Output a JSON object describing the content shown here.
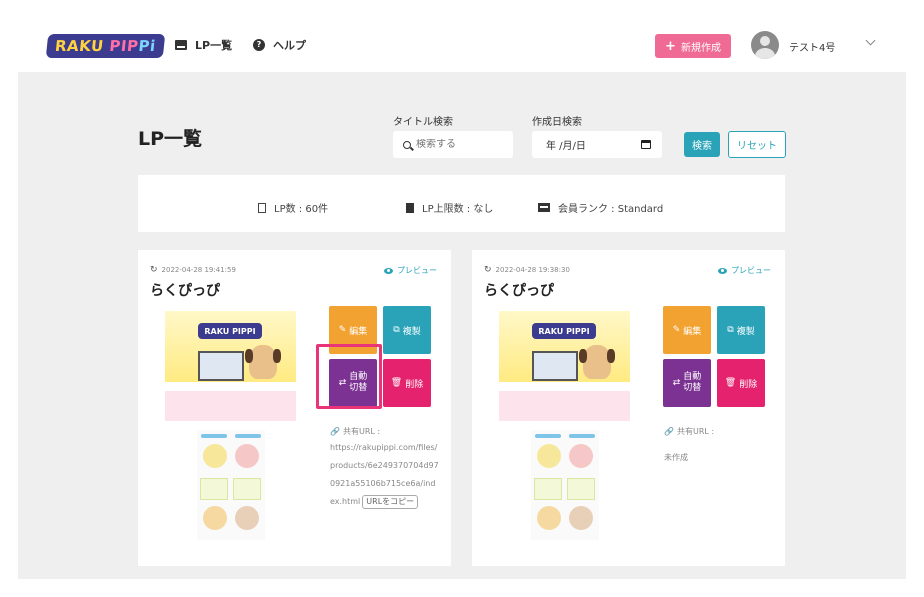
{
  "header": {
    "logo_text": "RAKU PIPPI",
    "nav": {
      "lp_list": "LP一覧",
      "help": "ヘルプ"
    },
    "new_button": "新規作成",
    "username": "テスト4号"
  },
  "main": {
    "title": "LP一覧",
    "title_search": {
      "label": "タイトル検索",
      "placeholder": "検索する"
    },
    "date_search": {
      "label": "作成日検索",
      "value": "年 /月/日"
    },
    "search_button": "検索",
    "reset_button": "リセット"
  },
  "stats": {
    "lp_count": "LP数 : 60件",
    "lp_limit": "LP上限数 : なし",
    "member_rank": "会員ランク : Standard"
  },
  "cards": [
    {
      "date": "2022-04-28 19:41:59",
      "preview": "プレビュー",
      "title": "らくぴっぴ",
      "actions": {
        "edit": "編集",
        "copy": "複製",
        "switch_line1": "自動",
        "switch_line2": "切替",
        "delete": "削除"
      },
      "share_label": "共有URL :",
      "share_url": "https://rakupippi.com/files/products/6e249370704d970921a55106b715ce6a/index.html",
      "copy_url_button": "URLをコピー"
    },
    {
      "date": "2022-04-28 19:38:30",
      "preview": "プレビュー",
      "title": "らくぴっぴ",
      "actions": {
        "edit": "編集",
        "copy": "複製",
        "switch_line1": "自動",
        "switch_line2": "切替",
        "delete": "削除"
      },
      "share_label": "共有URL :",
      "share_status": "未作成"
    }
  ],
  "colors": {
    "accent_teal": "#2aa3b8",
    "new_button_pink": "#f06a96",
    "edit_orange": "#f2a231",
    "switch_purple": "#7b3292",
    "delete_pink": "#e5226d",
    "highlight_pink": "#e9347a"
  }
}
